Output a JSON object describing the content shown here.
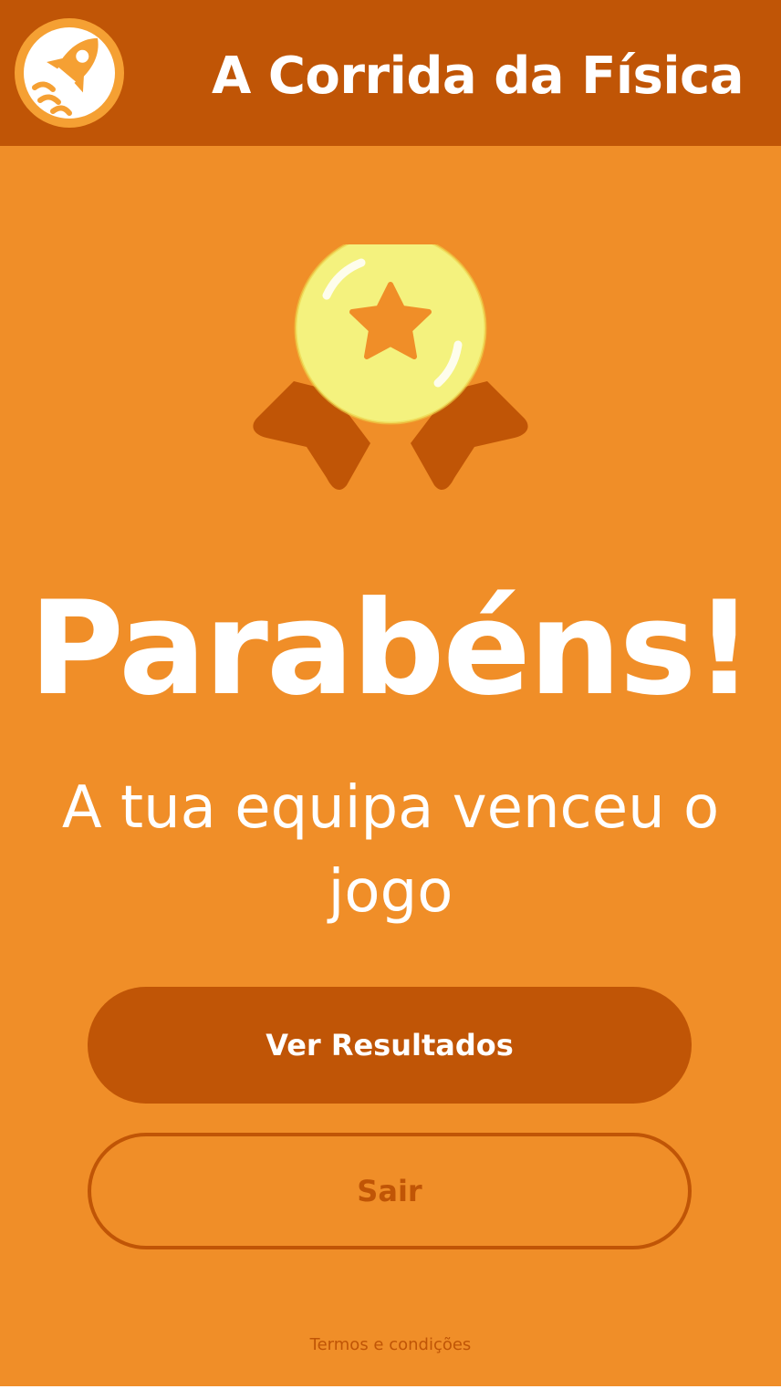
{
  "header": {
    "title": "A Corrida da Física",
    "logo_icon": "rocket-icon"
  },
  "result": {
    "badge_icon": "medal-star-icon",
    "headline": "Parabéns!",
    "message": "A tua equipa venceu o jogo"
  },
  "actions": {
    "view_results_label": "Ver Resultados",
    "exit_label": "Sair"
  },
  "footer": {
    "terms_link": "Termos e condições"
  },
  "colors": {
    "background": "#f08e28",
    "header": "#c05506",
    "primary_button": "#c05506",
    "medal": "#f4f27e",
    "ribbon": "#c05506",
    "text": "#ffffff"
  }
}
